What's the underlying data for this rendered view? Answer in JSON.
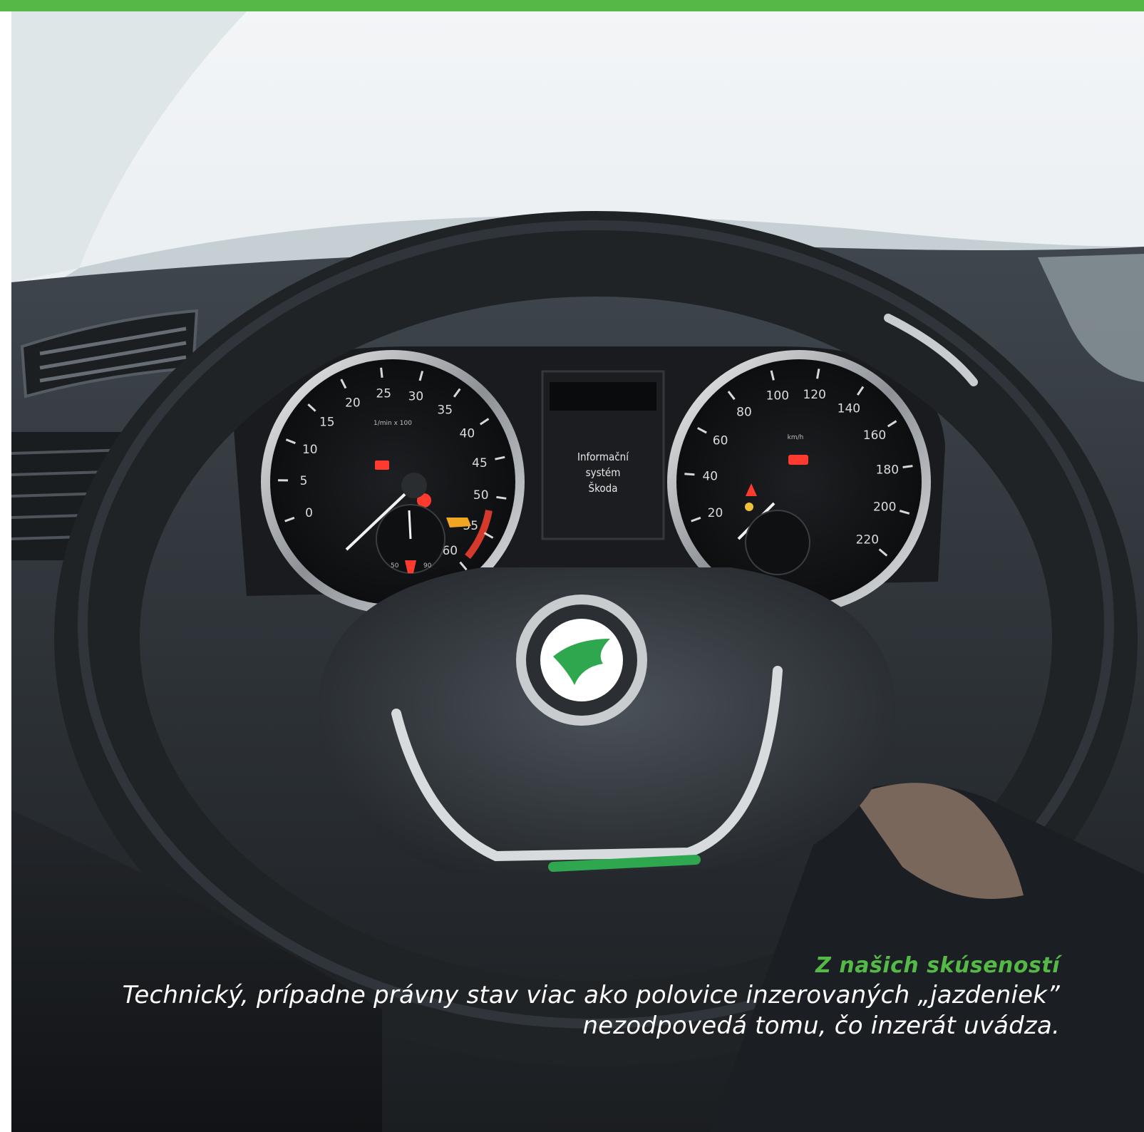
{
  "colors": {
    "brand_green": "#55b947",
    "caption_text": "#ffffff"
  },
  "cluster": {
    "display_lines": [
      "Informační",
      "systém",
      "Škoda"
    ],
    "tacho_unit": "1/min x 100",
    "speedo_unit": "km/h",
    "tacho_ticks": [
      "0",
      "5",
      "10",
      "15",
      "20",
      "25",
      "30",
      "35",
      "40",
      "45",
      "50",
      "55",
      "60"
    ],
    "speedo_ticks": [
      "20",
      "40",
      "60",
      "80",
      "100",
      "120",
      "140",
      "160",
      "180",
      "200",
      "220"
    ],
    "temp_gauge_labels": [
      "50",
      "90"
    ]
  },
  "caption": {
    "title": "Z našich skúseností",
    "line1": "Technický, prípadne právny stav viac ako polovice inzerovaných „jazdeniek”",
    "line2": "nezodpovedá tomu, čo inzerát uvádza."
  }
}
